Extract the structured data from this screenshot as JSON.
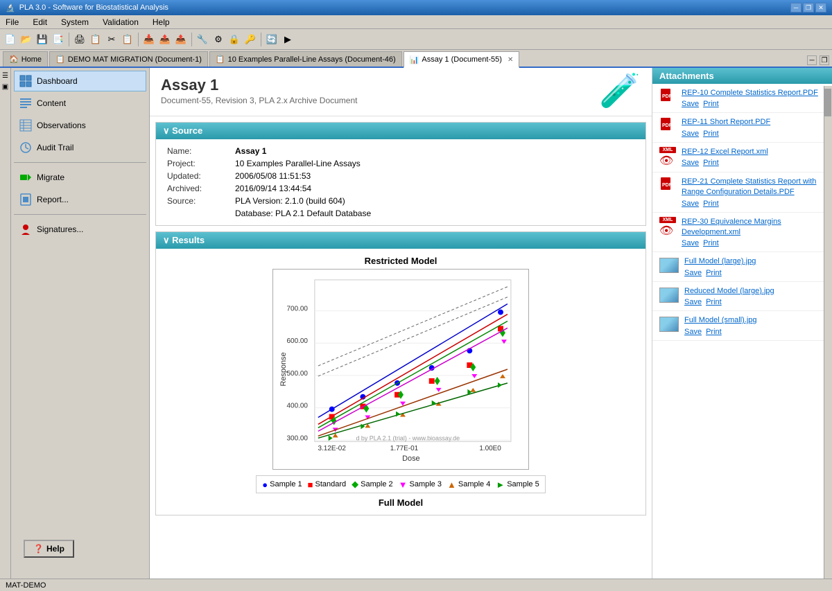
{
  "titleBar": {
    "title": "PLA 3.0 - Software for Biostatistical Analysis",
    "icon": "🔬",
    "minimizeBtn": "─",
    "restoreBtn": "❐",
    "closeBtn": "✕"
  },
  "menuBar": {
    "items": [
      "File",
      "Edit",
      "System",
      "Validation",
      "Help"
    ]
  },
  "tabs": [
    {
      "id": "home",
      "label": "Home",
      "icon": "🏠",
      "active": false,
      "closeable": false
    },
    {
      "id": "demo",
      "label": "DEMO MAT MIGRATION (Document-1)",
      "icon": "📋",
      "active": false,
      "closeable": false
    },
    {
      "id": "examples",
      "label": "10 Examples Parallel-Line Assays (Document-46)",
      "icon": "📋",
      "active": false,
      "closeable": false
    },
    {
      "id": "assay1",
      "label": "Assay 1 (Document-55)",
      "icon": "📊",
      "active": true,
      "closeable": true
    }
  ],
  "nav": {
    "items": [
      {
        "id": "dashboard",
        "label": "Dashboard",
        "icon": "grid",
        "active": true
      },
      {
        "id": "content",
        "label": "Content",
        "icon": "list",
        "active": false
      },
      {
        "id": "observations",
        "label": "Observations",
        "icon": "table",
        "active": false
      },
      {
        "id": "audittrail",
        "label": "Audit Trail",
        "icon": "clock",
        "active": false
      },
      {
        "id": "migrate",
        "label": "Migrate",
        "icon": "arrow",
        "active": false
      },
      {
        "id": "report",
        "label": "Report...",
        "icon": "chart",
        "active": false
      },
      {
        "id": "signatures",
        "label": "Signatures...",
        "icon": "ribbon",
        "active": false
      }
    ],
    "helpBtn": "Help"
  },
  "page": {
    "title": "Assay 1",
    "subtitle": "Document-55, Revision 3, PLA 2.x Archive Document"
  },
  "source": {
    "sectionTitle": "∨ Source",
    "fields": [
      {
        "label": "Name:",
        "value": "Assay 1",
        "bold": true
      },
      {
        "label": "Project:",
        "value": "10 Examples Parallel-Line Assays",
        "bold": false
      },
      {
        "label": "Updated:",
        "value": "2006/05/08 11:51:53",
        "bold": false
      },
      {
        "label": "Archived:",
        "value": "2016/09/14 13:44:54",
        "bold": false
      },
      {
        "label": "Source:",
        "value": "PLA Version: 2.1.0 (build 604)",
        "bold": false
      },
      {
        "label": "",
        "value": "Database: PLA 2.1 Default Database",
        "bold": false
      }
    ]
  },
  "results": {
    "sectionTitle": "∨ Results",
    "chartTitle": "Restricted Model",
    "chartFooter": "Full Model",
    "legend": [
      {
        "symbol": "●",
        "color": "#0000ff",
        "label": "Sample 1"
      },
      {
        "symbol": "■",
        "color": "#ff0000",
        "label": "Standard"
      },
      {
        "symbol": "◆",
        "color": "#00aa00",
        "label": "Sample 2"
      },
      {
        "symbol": "▼",
        "color": "#ff00ff",
        "label": "Sample 3"
      },
      {
        "symbol": "▲",
        "color": "#cc6600",
        "label": "Sample 4"
      },
      {
        "symbol": "►",
        "color": "#009900",
        "label": "Sample 5"
      }
    ],
    "xAxisLabel": "Dose",
    "yAxisLabel": "Response",
    "xTicks": [
      "3.12E-02",
      "1.77E-01",
      "1.00E0"
    ],
    "yTicks": [
      "300.00",
      "400.00",
      "500.00",
      "600.00",
      "700.00"
    ],
    "watermark": "d by PLA 2.1 (trial) - www.bioassay.de"
  },
  "attachments": {
    "title": "Attachments",
    "items": [
      {
        "type": "pdf",
        "name": "REP-10 Complete Statistics Report.PDF",
        "actions": [
          "Save",
          "Print"
        ]
      },
      {
        "type": "pdf",
        "name": "REP-11 Short Report.PDF",
        "actions": [
          "Save",
          "Print"
        ]
      },
      {
        "type": "xml",
        "name": "REP-12 Excel Report.xml",
        "actions": [
          "Save",
          "Print"
        ]
      },
      {
        "type": "pdf",
        "name": "REP-21 Complete Statistics Report with Range Configuration Details.PDF",
        "actions": [
          "Save",
          "Print"
        ]
      },
      {
        "type": "xml",
        "name": "REP-30 Equivalence Margins Development.xml",
        "actions": [
          "Save",
          "Print"
        ]
      },
      {
        "type": "img",
        "name": "Full Model (large).jpg",
        "actions": [
          "Save",
          "Print"
        ]
      },
      {
        "type": "img",
        "name": "Reduced Model (large).jpg",
        "actions": [
          "Save",
          "Print"
        ]
      },
      {
        "type": "img",
        "name": "Full Model (small).jpg",
        "actions": [
          "Save",
          "Print"
        ]
      }
    ]
  },
  "statusBar": {
    "text": "MAT-DEMO"
  }
}
